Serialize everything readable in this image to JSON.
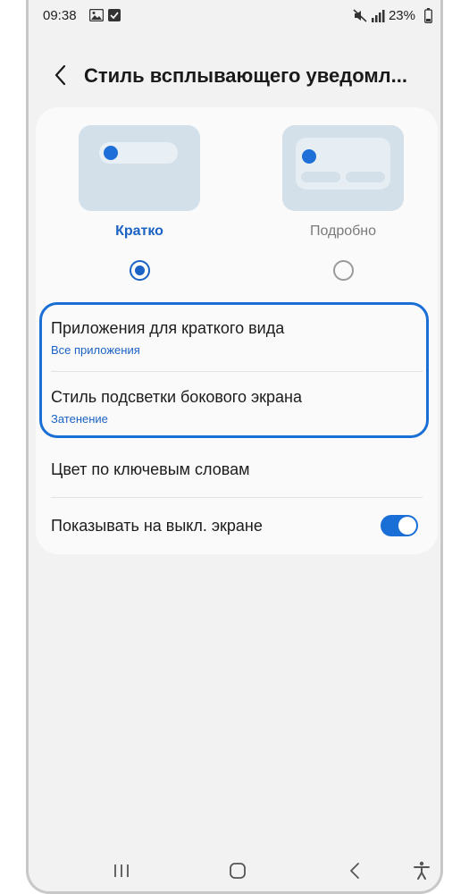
{
  "status_bar": {
    "time": "09:38",
    "battery": "23%",
    "icons": [
      "gallery-icon",
      "checkbox-notification-icon",
      "mute-icon",
      "signal-icon",
      "battery-icon"
    ]
  },
  "header": {
    "title": "Стиль всплывающего уведомл..."
  },
  "style_options": [
    {
      "label": "Кратко",
      "selected": true
    },
    {
      "label": "Подробно",
      "selected": false
    }
  ],
  "settings": {
    "brief_apps": {
      "title": "Приложения для краткого вида",
      "value": "Все приложения"
    },
    "edge_lighting": {
      "title": "Стиль подсветки бокового экрана",
      "value": "Затенение"
    },
    "keyword_color": {
      "title": "Цвет по ключевым словам"
    },
    "show_on_aod": {
      "title": "Показывать на выкл. экране",
      "enabled": true
    }
  },
  "colors": {
    "accent": "#1a62c4",
    "highlight": "#1a6fd6",
    "preview_bg": "#d4e0e9",
    "background": "#f2f2f2"
  },
  "nav_bar": {
    "icons": [
      "recents-icon",
      "home-icon",
      "back-nav-icon",
      "accessibility-icon"
    ]
  }
}
